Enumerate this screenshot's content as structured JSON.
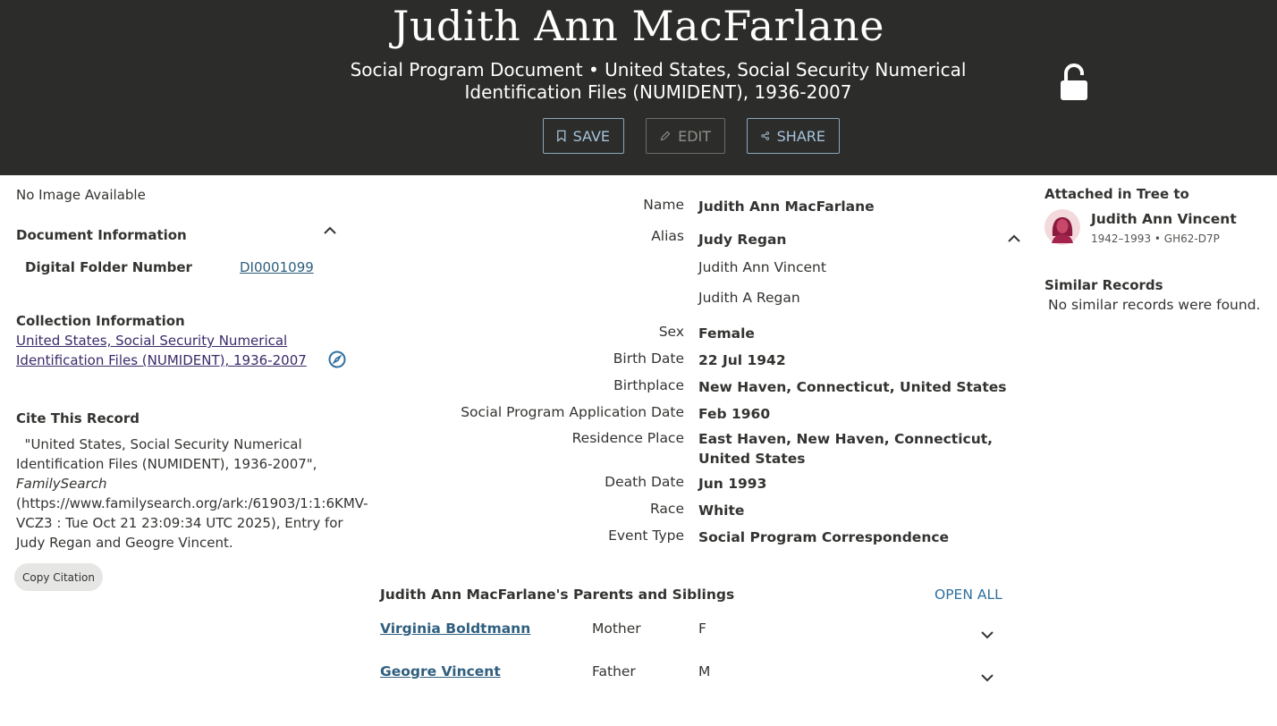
{
  "header": {
    "title": "Judith Ann MacFarlane",
    "subtitle": "Social Program Document • United States, Social Security Numerical Identification Files (NUMIDENT), 1936-2007",
    "buttons": {
      "save": "SAVE",
      "edit": "EDIT",
      "share": "SHARE"
    }
  },
  "left": {
    "no_image": "No Image Available",
    "document_information": {
      "title": "Document Information",
      "digital_folder_label": "Digital Folder Number",
      "digital_folder_value": "DI0001099"
    },
    "collection_information": {
      "title": "Collection Information",
      "link": "United States, Social Security Numerical Identification Files (NUMIDENT), 1936-2007"
    },
    "cite": {
      "title": "Cite This Record",
      "text_pre": "\"United States, Social Security Numerical Identification Files (NUMIDENT), 1936-2007\",",
      "source": "FamilySearch",
      "text_post": "(https://www.familysearch.org/ark:/61903/1:1:6KMV-VCZ3 : Tue Oct 21 23:09:34 UTC 2025), Entry for Judy Regan and Geogre Vincent.",
      "copy_button": "Copy Citation"
    }
  },
  "details": {
    "name_label": "Name",
    "name_value": "Judith Ann MacFarlane",
    "alias_label": "Alias",
    "alias_values": [
      "Judy Regan",
      "Judith Ann Vincent",
      "Judith A Regan"
    ],
    "sex_label": "Sex",
    "sex_value": "Female",
    "birth_date_label": "Birth Date",
    "birth_date_value": "22 Jul 1942",
    "birthplace_label": "Birthplace",
    "birthplace_value": "New Haven, Connecticut, United States",
    "app_date_label": "Social Program Application Date",
    "app_date_value": "Feb 1960",
    "residence_label": "Residence Place",
    "residence_value": "East Haven, New Haven, Connecticut, United States",
    "death_date_label": "Death Date",
    "death_date_value": "Jun 1993",
    "race_label": "Race",
    "race_value": "White",
    "event_type_label": "Event Type",
    "event_type_value": "Social Program Correspondence"
  },
  "parents_siblings": {
    "title": "Judith Ann MacFarlane's Parents and Siblings",
    "open_all": "OPEN ALL",
    "rows": [
      {
        "name": "Virginia Boldtmann",
        "role": "Mother",
        "sex": "F"
      },
      {
        "name": "Geogre Vincent",
        "role": "Father",
        "sex": "M"
      }
    ]
  },
  "right": {
    "attached_title": "Attached in Tree to",
    "person_name": "Judith Ann Vincent",
    "person_meta": "1942–1993 • GH62-D7P",
    "similar_title": "Similar Records",
    "similar_text": "No similar records were found."
  },
  "colors": {
    "header_bg": "#2c2c2a",
    "link": "#2f5f7f",
    "visited_link": "#3b2a6a",
    "accent": "#2f6f9f"
  },
  "icons": [
    "bookmark-icon",
    "pencil-icon",
    "share-icon",
    "lock-icon",
    "chevron-up-icon",
    "compass-icon",
    "chevron-down-icon",
    "avatar-female-icon"
  ]
}
